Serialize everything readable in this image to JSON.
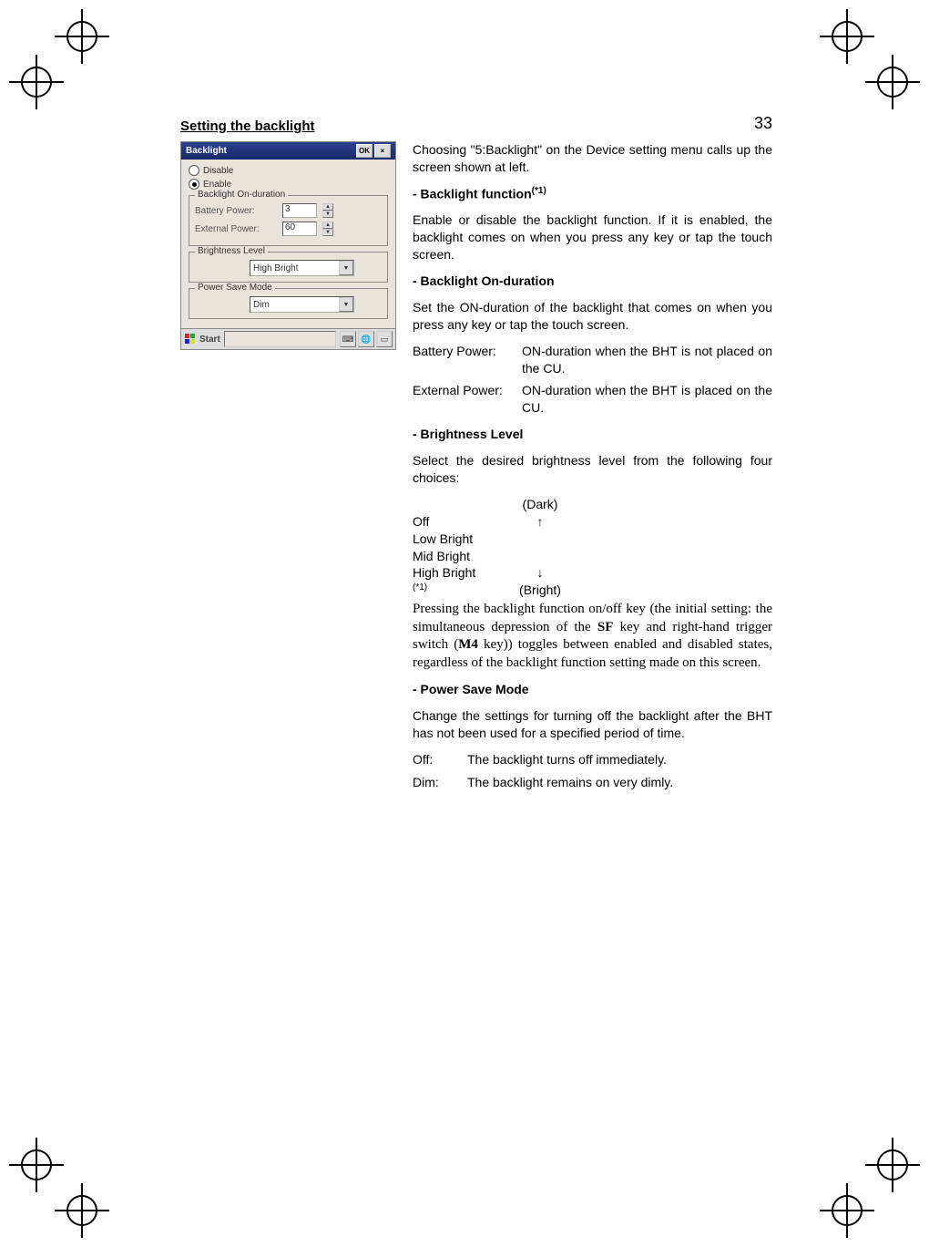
{
  "page_number": "33",
  "section_title": "Setting the backlight",
  "screenshot": {
    "title": "Backlight",
    "ok": "OK",
    "close": "×",
    "radio_disable": "Disable",
    "radio_enable": "Enable",
    "group_on_duration": "Backlight On-duration",
    "battery_label": "Battery Power:",
    "battery_value": "3",
    "external_label": "External Power:",
    "external_value": "60",
    "group_brightness": "Brightness Level",
    "brightness_value": "High Bright",
    "group_psm": "Power Save Mode",
    "psm_value": "Dim",
    "start": "Start"
  },
  "body": {
    "intro": "Choosing \"5:Backlight\" on the Device setting menu calls up the screen shown at left.",
    "h_backlight_fn": "- Backlight function",
    "sup1": "(*1)",
    "backlight_fn_text": "Enable or disable the backlight function. If it is enabled, the backlight comes on when you press any key or tap the touch screen.",
    "h_on_duration": "- Backlight On-duration",
    "on_duration_text": "Set the ON-duration of the backlight that comes on when you press any key or tap the touch screen.",
    "battery_term": "Battery Power:",
    "battery_desc": "ON-duration when the BHT is not placed on the CU.",
    "external_term": "External Power:",
    "external_desc": "ON-duration when the BHT is placed on the CU.",
    "h_brightness": "- Brightness Level",
    "brightness_text": "Select the desired brightness level from the following four choices:",
    "dark": "(Dark)",
    "off": "Off",
    "up": "↑",
    "low": "Low Bright",
    "mid": "Mid Bright",
    "high": "High Bright",
    "down": "↓",
    "bright": "(Bright)",
    "note_star": "(*1)",
    "serif_note_1": "Pressing the backlight function on/off key (the initial setting: the simultaneous depression of the ",
    "serif_sf": "SF",
    "serif_note_2": " key and right-hand trigger switch (",
    "serif_m4": "M4",
    "serif_note_3": " key)) toggles between enabled and disabled states, regardless of the backlight function setting made on this screen.",
    "h_psm": "- Power Save Mode",
    "psm_text": "Change the settings for turning off the backlight after the BHT has not been used for a specified period of time.",
    "off_term": "Off:",
    "off_desc": "The backlight turns off immediately.",
    "dim_term": "Dim:",
    "dim_desc": "The backlight remains on very dimly."
  }
}
